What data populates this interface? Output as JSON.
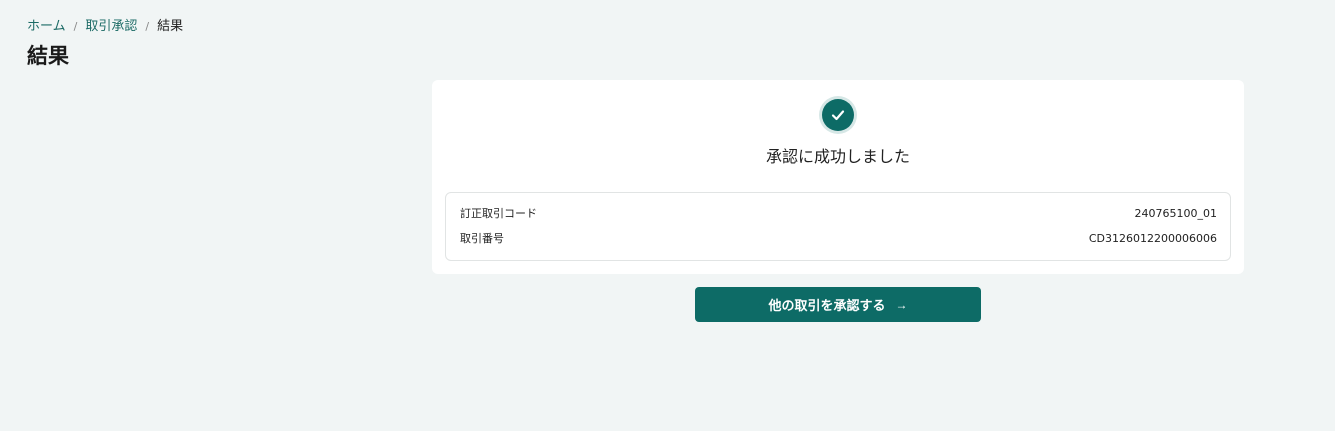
{
  "breadcrumb": {
    "home": "ホーム",
    "separator": "/",
    "approval": "取引承認",
    "current": "結果"
  },
  "page": {
    "title": "結果"
  },
  "result": {
    "message": "承認に成功しました",
    "icon": "check-icon",
    "details": [
      {
        "label": "訂正取引コード",
        "value": "240765100_01"
      },
      {
        "label": "取引番号",
        "value": "CD3126012200006006"
      }
    ]
  },
  "actions": {
    "approve_other_label": "他の取引を承認する",
    "arrow": "→"
  },
  "colors": {
    "accent": "#0d6b66",
    "background": "#f1f5f5",
    "link": "#1c6b66"
  }
}
